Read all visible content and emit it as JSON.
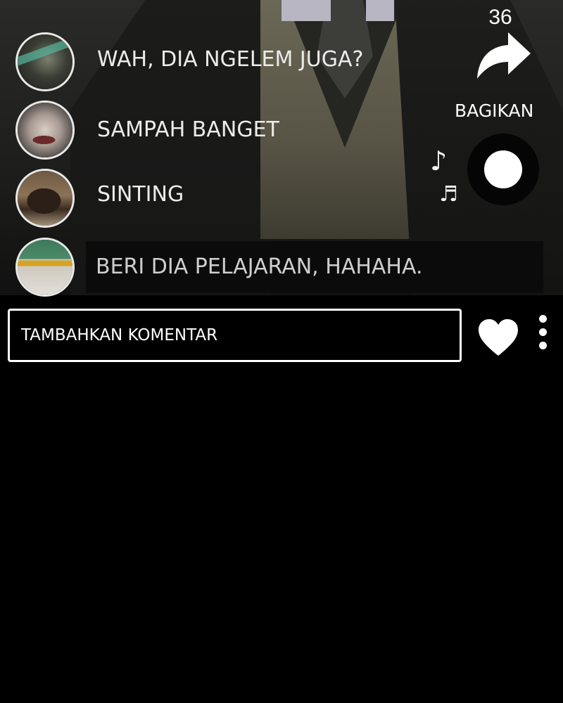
{
  "comments": [
    {
      "avatar": "avatar-man-with-cap",
      "text": "WAH, DIA NGELEM JUGA?"
    },
    {
      "avatar": "avatar-smiling-man",
      "text": "SAMPAH BANGET"
    },
    {
      "avatar": "avatar-cat",
      "text": "SINTING"
    },
    {
      "avatar": "avatar-man-sunglasses",
      "text": "BERI DIA PELAJARAN, HAHAHA."
    }
  ],
  "share": {
    "count": "36",
    "label": "BAGIKAN",
    "icon": "share-arrow-icon"
  },
  "music": {
    "icon": "music-disc-icon",
    "notes": [
      "♪",
      "♬"
    ]
  },
  "input": {
    "placeholder": "TAMBAHKAN KOMENTAR"
  },
  "actions": {
    "like_icon": "heart-icon",
    "more_icon": "more-vertical-icon"
  },
  "colors": {
    "background": "#000000",
    "text": "#ececea",
    "accent": "#ffffff"
  }
}
